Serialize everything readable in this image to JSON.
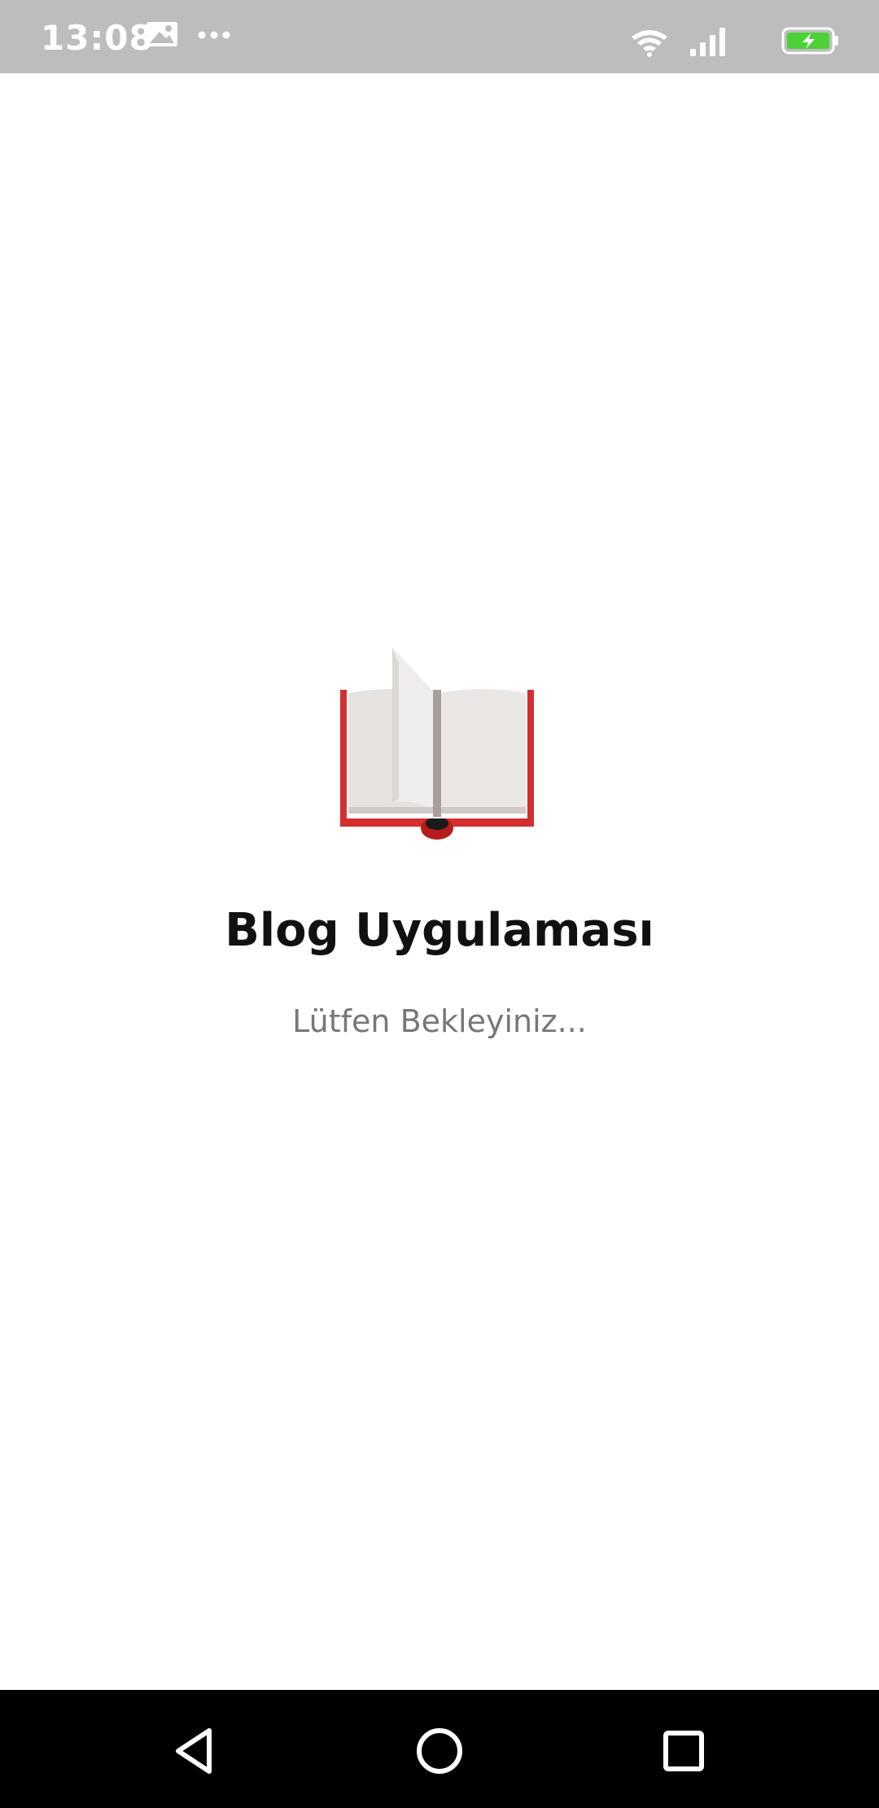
{
  "status_bar": {
    "time": "13:08",
    "background_color": "#bdbdbd",
    "icons": [
      "gallery-icon",
      "more-dots-icon",
      "wifi-icon",
      "cellular-signal-icon",
      "battery-charging-icon"
    ],
    "battery_color": "#4cd137"
  },
  "splash": {
    "logo": "open-book-icon",
    "title": "Blog Uygulaması",
    "subtitle": "Lütfen Bekleyiniz...",
    "accent_color": "#d32f2f"
  },
  "nav_bar": {
    "buttons": [
      "back",
      "home",
      "recents"
    ]
  }
}
